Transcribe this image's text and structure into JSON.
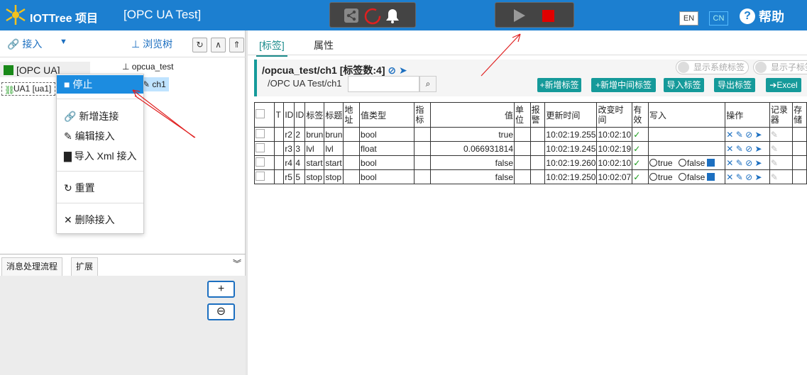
{
  "topbar": {
    "app_title": "IOTTree 项目",
    "project_title": "[OPC UA Test]",
    "lang_en": "EN",
    "lang_cn": "CN",
    "help_label": "帮助"
  },
  "left": {
    "connect_label": "接入",
    "browse_label": "浏览树",
    "tree_root_label": "[OPC UA]",
    "ua1_label": "UA1 [ua1]",
    "opcua_node": "opcua_test",
    "ch1_node": "ch1"
  },
  "menu": {
    "items": [
      {
        "label": "停止"
      },
      {
        "label": "新增连接"
      },
      {
        "label": "编辑接入"
      },
      {
        "label": "导入 Xml 接入"
      },
      {
        "label": "重置"
      },
      {
        "label": "删除接入"
      }
    ]
  },
  "bottom_tabs": [
    "消息处理流程",
    "扩展"
  ],
  "right": {
    "tab_tags": "[标签]",
    "tab_props": "属性",
    "path": "/opcua_test/ch1 [标签数:4]",
    "subpath": "/OPC UA Test/ch1",
    "show_sys_tags": "显示系统标签",
    "show_sub_tags": "显示子标签",
    "btn_add_tag": "+新增标签",
    "btn_add_mid_tag": "+新增中间标签",
    "btn_import": "导入标签",
    "btn_export": "导出标签",
    "btn_excel": "Excel"
  },
  "table": {
    "headers": [
      "",
      "T",
      "ID",
      "ID",
      "标签",
      "标题",
      "地址",
      "值类型",
      "指标",
      "值",
      "单位",
      "报警",
      "更新时间",
      "改变时间",
      "有效",
      "写入",
      "操作",
      "记录器",
      "存储"
    ],
    "rows": [
      {
        "t": "",
        "id1": "r2",
        "id2": "2",
        "tag": "brun",
        "title": "brun",
        "addr": "",
        "vtype": "bool",
        "ind": "",
        "value": "true",
        "unit": "",
        "alarm": "",
        "upd": "10:02:19.255",
        "chg": "10:02:10",
        "valid": "✓",
        "write": false
      },
      {
        "t": "",
        "id1": "r3",
        "id2": "3",
        "tag": "lvl",
        "title": "lvl",
        "addr": "",
        "vtype": "float",
        "ind": "",
        "value": "0.066931814",
        "unit": "",
        "alarm": "",
        "upd": "10:02:19.245",
        "chg": "10:02:19",
        "valid": "✓",
        "write": false
      },
      {
        "t": "",
        "id1": "r4",
        "id2": "4",
        "tag": "start",
        "title": "start",
        "addr": "",
        "vtype": "bool",
        "ind": "",
        "value": "false",
        "unit": "",
        "alarm": "",
        "upd": "10:02:19.260",
        "chg": "10:02:10",
        "valid": "✓",
        "write": true
      },
      {
        "t": "",
        "id1": "r5",
        "id2": "5",
        "tag": "stop",
        "title": "stop",
        "addr": "",
        "vtype": "bool",
        "ind": "",
        "value": "false",
        "unit": "",
        "alarm": "",
        "upd": "10:02:19.250",
        "chg": "10:02:07",
        "valid": "✓",
        "write": true
      }
    ],
    "write_true": "true",
    "write_false": "false"
  },
  "colors": {
    "topbar": "#1c7fd0",
    "accent": "#159a9a",
    "menu_active": "#1c8ce0",
    "annotation_arrow": "#e02020"
  }
}
